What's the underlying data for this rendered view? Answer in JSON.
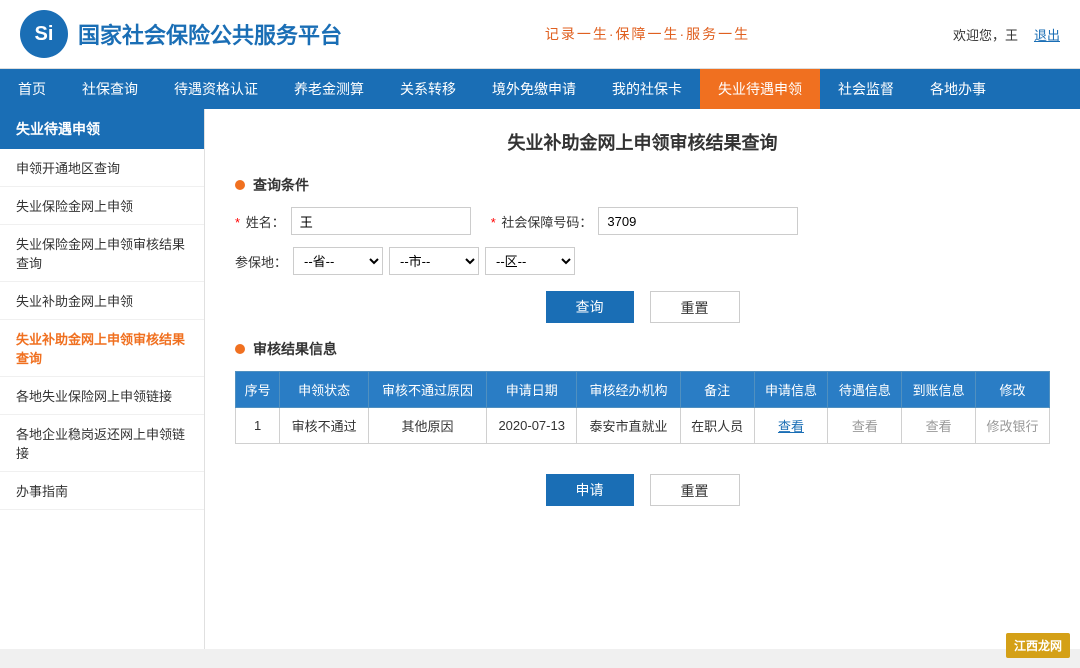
{
  "header": {
    "logo_text": "国家社会保险公共服务平台",
    "logo_abbr": "Si",
    "slogan": "记录一生·保障一生·服务一生",
    "welcome": "欢迎您，王",
    "logout": "退出"
  },
  "nav": {
    "items": [
      {
        "label": "首页",
        "active": false
      },
      {
        "label": "社保查询",
        "active": false
      },
      {
        "label": "待遇资格认证",
        "active": false
      },
      {
        "label": "养老金测算",
        "active": false
      },
      {
        "label": "关系转移",
        "active": false
      },
      {
        "label": "境外免缴申请",
        "active": false
      },
      {
        "label": "我的社保卡",
        "active": false
      },
      {
        "label": "失业待遇申领",
        "active": true
      },
      {
        "label": "社会监督",
        "active": false
      },
      {
        "label": "各地办事",
        "active": false
      }
    ]
  },
  "sidebar": {
    "header": "失业待遇申领",
    "items": [
      {
        "label": "申领开通地区查询",
        "active": false
      },
      {
        "label": "失业保险金网上申领",
        "active": false
      },
      {
        "label": "失业保险金网上申领审核结果查询",
        "active": false
      },
      {
        "label": "失业补助金网上申领",
        "active": false
      },
      {
        "label": "失业补助金网上申领审核结果查询",
        "active": true
      },
      {
        "label": "各地失业保险网上申领链接",
        "active": false
      },
      {
        "label": "各地企业稳岗返还网上申领链接",
        "active": false
      },
      {
        "label": "办事指南",
        "active": false
      }
    ]
  },
  "content": {
    "page_title": "失业补助金网上申领审核结果查询",
    "query_section_label": "查询条件",
    "result_section_label": "审核结果信息",
    "form": {
      "name_label": "姓名：",
      "name_value": "王",
      "social_id_label": "社会保障号码：",
      "social_id_value": "3709",
      "location_label": "参保地：",
      "province_placeholder": "--省--",
      "city_placeholder": "--市--",
      "district_placeholder": "--区--"
    },
    "buttons": {
      "query": "查询",
      "reset": "重置",
      "apply": "申请",
      "reset2": "重置"
    },
    "table": {
      "headers": [
        "序号",
        "申领状态",
        "审核不通过原因",
        "申请日期",
        "审核经办机构",
        "备注",
        "申请信息",
        "待遇信息",
        "到账信息",
        "修改"
      ],
      "rows": [
        {
          "seq": "1",
          "status": "审核不通过",
          "reason": "其他原因",
          "date": "2020-07-13",
          "org": "泰安市直就业",
          "remark": "在职人员",
          "apply_info": "查看",
          "benefit_info": "查看",
          "arrival_info": "查看",
          "modify": "修改银行"
        }
      ]
    }
  },
  "watermark": "江西龙网"
}
